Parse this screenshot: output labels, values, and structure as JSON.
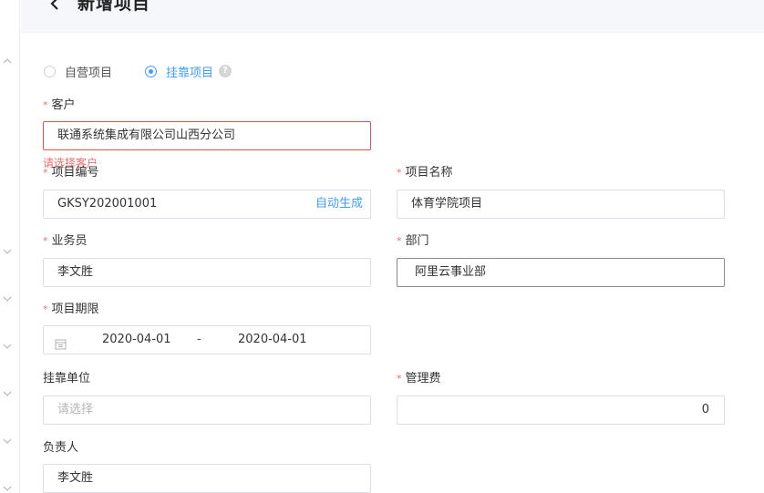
{
  "header": {
    "title": "新增项目"
  },
  "project_type": {
    "options": [
      {
        "label": "自营项目",
        "selected": false
      },
      {
        "label": "挂靠项目",
        "selected": true
      }
    ],
    "help_icon": "question-circle-icon"
  },
  "form": {
    "customer": {
      "label": "客户",
      "required": true,
      "value": "联通系统集成有限公司山西分公司",
      "error": "请选择客户"
    },
    "project_no": {
      "label": "项目编号",
      "required": true,
      "value": "GKSY202001001",
      "action": "自动生成"
    },
    "project_name": {
      "label": "项目名称",
      "required": true,
      "value": "体育学院项目"
    },
    "salesperson": {
      "label": "业务员",
      "required": true,
      "value": "李文胜"
    },
    "department": {
      "label": "部门",
      "required": true,
      "value": "阿里云事业部"
    },
    "period": {
      "label": "项目期限",
      "required": true,
      "start": "2020-04-01",
      "separator": "-",
      "end": "2020-04-01"
    },
    "affiliate": {
      "label": "挂靠单位",
      "required": false,
      "placeholder": "请选择"
    },
    "management_fee": {
      "label": "管理费",
      "required": true,
      "value": "0"
    },
    "owner": {
      "label": "负责人",
      "required": false,
      "value": "李文胜"
    }
  },
  "required_mark": "*",
  "colors": {
    "accent": "#409eff",
    "error": "#f56c6c",
    "error_border": "#d9534f"
  }
}
